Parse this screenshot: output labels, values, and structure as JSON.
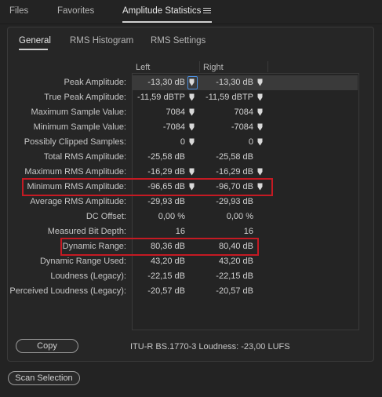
{
  "panel_tabs": {
    "files": "Files",
    "favorites": "Favorites",
    "amplitude": "Amplitude Statistics"
  },
  "sub_tabs": {
    "general": "General",
    "rms_histogram": "RMS Histogram",
    "rms_settings": "RMS Settings"
  },
  "columns": {
    "left": "Left",
    "right": "Right"
  },
  "rows": [
    {
      "label": "Peak Amplitude:",
      "left": "-13,30 dB",
      "right": "-13,30 dB",
      "pin_left": true,
      "pin_right": true,
      "highlighted": true
    },
    {
      "label": "True Peak Amplitude:",
      "left": "-11,59 dBTP",
      "right": "-11,59 dBTP",
      "pin_left": true,
      "pin_right": true
    },
    {
      "label": "Maximum Sample Value:",
      "left": "7084",
      "right": "7084",
      "pin_left": true,
      "pin_right": true
    },
    {
      "label": "Minimum Sample Value:",
      "left": "-7084",
      "right": "-7084",
      "pin_left": true,
      "pin_right": true
    },
    {
      "label": "Possibly Clipped Samples:",
      "left": "0",
      "right": "0",
      "pin_left": true,
      "pin_right": true
    },
    {
      "label": "Total RMS Amplitude:",
      "left": "-25,58 dB",
      "right": "-25,58 dB"
    },
    {
      "label": "Maximum RMS Amplitude:",
      "left": "-16,29 dB",
      "right": "-16,29 dB",
      "pin_left": true,
      "pin_right": true
    },
    {
      "label": "Minimum RMS Amplitude:",
      "left": "-96,65 dB",
      "right": "-96,70 dB",
      "pin_left": true,
      "pin_right": true,
      "red_box": true
    },
    {
      "label": "Average RMS Amplitude:",
      "left": "-29,93 dB",
      "right": "-29,93 dB"
    },
    {
      "label": "DC Offset:",
      "left": "0,00 %",
      "right": "0,00 %"
    },
    {
      "label": "Measured Bit Depth:",
      "left": "16",
      "right": "16"
    },
    {
      "label": "Dynamic Range:",
      "left": "80,36 dB",
      "right": "80,40 dB",
      "red_box": true
    },
    {
      "label": "Dynamic Range Used:",
      "left": "43,20 dB",
      "right": "43,20 dB"
    },
    {
      "label": "Loudness (Legacy):",
      "left": "-22,15 dB",
      "right": "-22,15 dB"
    },
    {
      "label": "Perceived Loudness (Legacy):",
      "left": "-20,57 dB",
      "right": "-20,57 dB"
    }
  ],
  "copy_button": "Copy",
  "loudness_text": "ITU-R BS.1770-3 Loudness:  -23,00 LUFS",
  "scan_button": "Scan Selection",
  "colors": {
    "highlight_box": "#c51a23",
    "focus": "#4a8fe0",
    "background": "#232323"
  }
}
